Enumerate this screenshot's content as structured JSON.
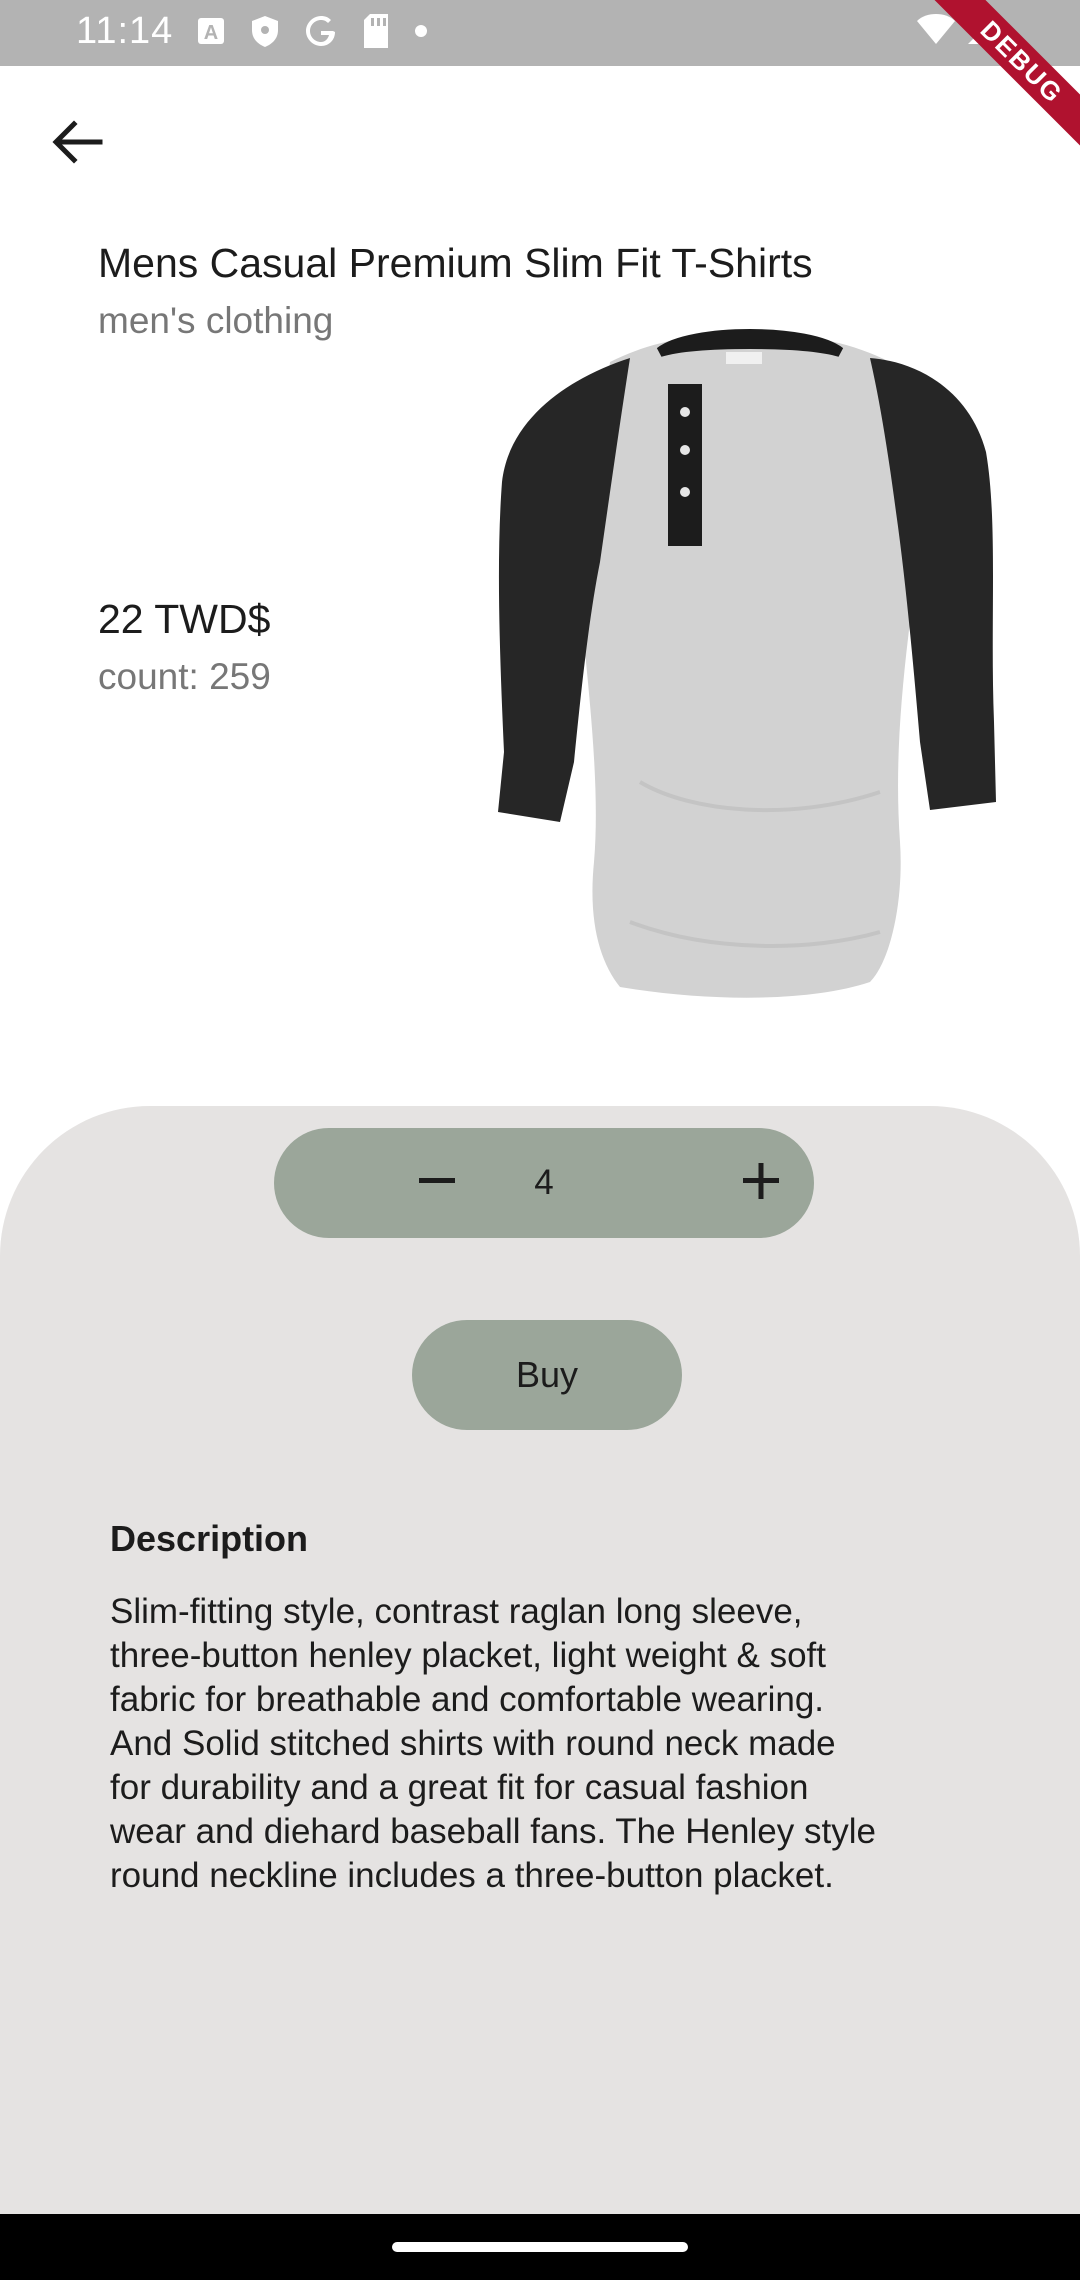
{
  "status_bar": {
    "time": "11:14",
    "icons": [
      "a-letter-icon",
      "shield-icon",
      "google-g-icon",
      "sim-card-icon",
      "dot-icon",
      "wifi-icon",
      "signal-icon"
    ]
  },
  "debug_banner": {
    "label": "DEBUG"
  },
  "product": {
    "title": "Mens Casual Premium Slim Fit T-Shirts",
    "category": "men's clothing",
    "price": "22 TWD$",
    "count": "count: 259",
    "image_icon": "henley-tshirt-illustration"
  },
  "quantity": {
    "value": "4",
    "decrease_icon": "minus-icon",
    "increase_icon": "plus-icon"
  },
  "buy": {
    "label": "Buy"
  },
  "description": {
    "heading": "Description",
    "lines": [
      "Slim-fitting style, contrast raglan long sleeve,",
      "three-button henley placket, light weight & soft",
      "fabric for breathable and comfortable wearing.",
      "And Solid stitched shirts with round neck made",
      "for durability and a great fit for casual fashion",
      "wear and diehard baseball fans. The Henley style",
      "round neckline includes a three-button placket."
    ]
  },
  "colors": {
    "status_bar": "#b3b3b3",
    "sheet": "#e5e3e2",
    "accent_button": "#9ba69a",
    "debug_ribbon": "#b0122f"
  }
}
